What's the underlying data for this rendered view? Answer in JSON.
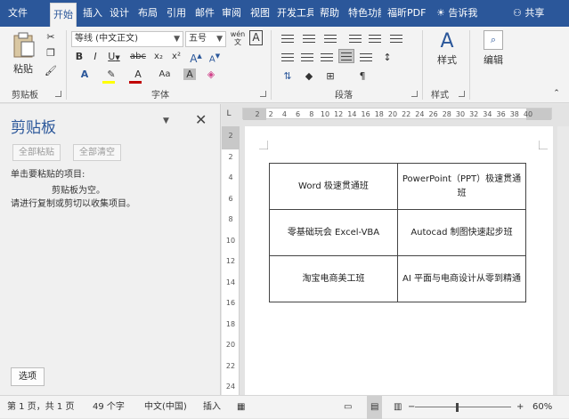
{
  "tabs": [
    "文件",
    "开始",
    "插入",
    "设计",
    "布局",
    "引用",
    "邮件",
    "审阅",
    "视图",
    "开发工具",
    "帮助",
    "特色功能",
    "福昕PDF"
  ],
  "active_tab": "开始",
  "tell_me": "告诉我",
  "share": "共享",
  "ribbon": {
    "clipboard": {
      "paste": "粘贴",
      "label": "剪贴板"
    },
    "font": {
      "name": "等线 (中文正文)",
      "size": "五号",
      "label": "字体",
      "bold": "B",
      "italic": "I",
      "underline": "U",
      "strike": "abc",
      "sub": "x₂",
      "sup": "x²",
      "font_color": "A",
      "change_case": "Aa",
      "grow": "A",
      "shrink": "A",
      "wen": "wén",
      "border_char": "A"
    },
    "paragraph": {
      "label": "段落"
    },
    "styles": {
      "btn": "样式",
      "label": "样式"
    },
    "editing": {
      "btn": "编辑"
    }
  },
  "clipboard_pane": {
    "title": "剪贴板",
    "paste_all": "全部粘贴",
    "clear_all": "全部清空",
    "instruction": "单击要粘贴的项目:",
    "empty_line1": "剪贴板为空。",
    "empty_line2": "请进行复制或剪切以收集项目。",
    "options": "选项"
  },
  "ruler": {
    "corner": "L",
    "h_numbers": [
      "2",
      "2",
      "4",
      "6",
      "8",
      "10",
      "12",
      "14",
      "16",
      "18",
      "20",
      "22",
      "24",
      "26",
      "28",
      "30",
      "32",
      "34",
      "36",
      "38",
      "40"
    ],
    "v_numbers": [
      "2",
      "2",
      "4",
      "6",
      "8",
      "10",
      "12",
      "14",
      "16",
      "18",
      "20",
      "22",
      "24"
    ]
  },
  "doc_table": [
    [
      "Word 极速贯通班",
      "PowerPoint（PPT）极速贯通班"
    ],
    [
      "零基础玩会 Excel-VBA",
      "Autocad 制图快速起步班"
    ],
    [
      "淘宝电商美工班",
      "AI 平面与电商设计从零到精通"
    ]
  ],
  "status": {
    "page": "第 1 页，共 1 页",
    "words": "49 个字",
    "lang": "中文(中国)",
    "mode": "插入",
    "zoom": "60%",
    "minus": "−",
    "plus": "+"
  },
  "colors": {
    "accent": "#2b579a",
    "font_color_bar": "#c00000",
    "highlight_bar": "#ffff00"
  }
}
